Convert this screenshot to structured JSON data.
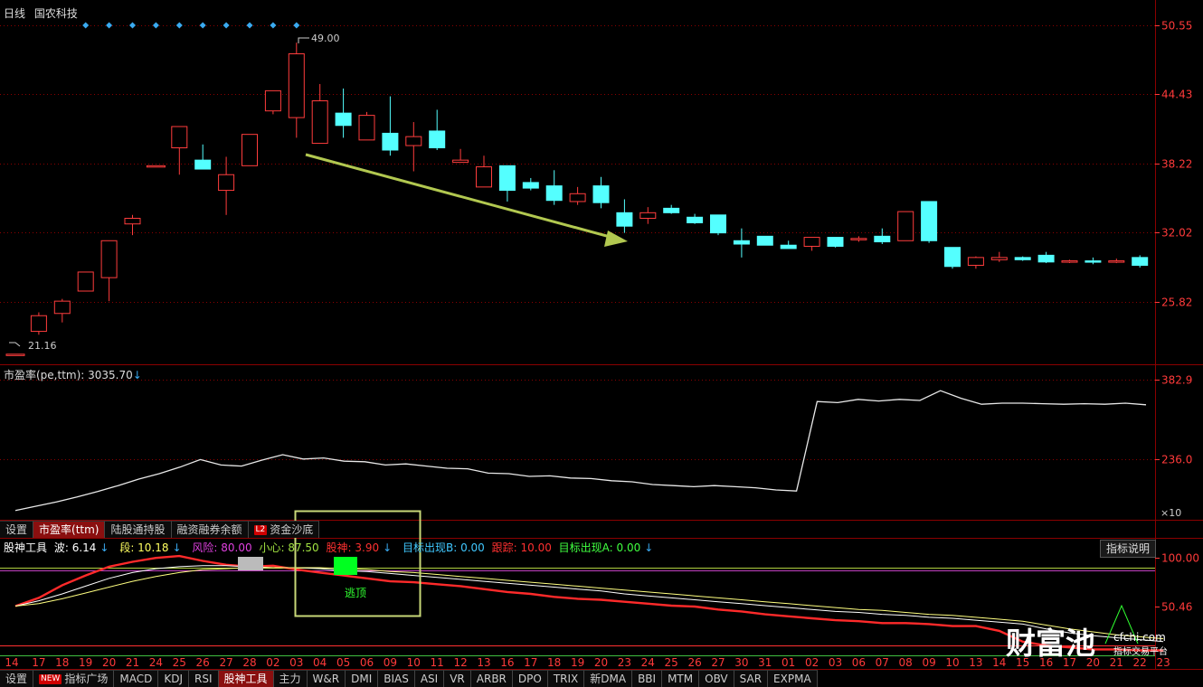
{
  "header": {
    "period": "日线",
    "stock_name": "国农科技"
  },
  "colors": {
    "up": "#ff3d3d",
    "down": "#54ffff",
    "axis_red": "#ff3a3a",
    "grid_red": "#8b0000",
    "pe_line": "#e8e8e8",
    "annotation_box": "#c8d878",
    "arrow": "#b2c850",
    "diamond": "#3aaaf0"
  },
  "chart_data": [
    {
      "type": "candlestick",
      "name": "price",
      "y_ticks": [
        "50.55",
        "44.43",
        "38.22",
        "32.02",
        "25.82"
      ],
      "ylim": [
        20.5,
        52.0
      ],
      "candles": [
        [
          21.16,
          21.16,
          21.16,
          21.16
        ],
        [
          23.2,
          24.6,
          22.9,
          24.9
        ],
        [
          24.8,
          25.9,
          24.0,
          26.1
        ],
        [
          26.8,
          28.5,
          26.8,
          28.5
        ],
        [
          28.0,
          31.3,
          25.9,
          31.3
        ],
        [
          32.8,
          33.3,
          31.8,
          33.6
        ],
        [
          38.0,
          38.0,
          38.0,
          38.0
        ],
        [
          39.6,
          41.5,
          37.2,
          41.5
        ],
        [
          38.5,
          37.7,
          37.7,
          39.9
        ],
        [
          35.8,
          37.2,
          33.6,
          38.8
        ],
        [
          38.0,
          40.8,
          38.0,
          40.8
        ],
        [
          42.9,
          44.7,
          42.6,
          44.7
        ],
        [
          42.3,
          48.0,
          40.5,
          49.0
        ],
        [
          40.0,
          43.8,
          40.0,
          45.3
        ],
        [
          42.7,
          41.6,
          40.5,
          44.9
        ],
        [
          40.3,
          42.5,
          40.3,
          42.8
        ],
        [
          40.9,
          39.4,
          38.9,
          44.2
        ],
        [
          39.8,
          40.6,
          37.5,
          41.9
        ],
        [
          41.1,
          39.6,
          39.4,
          43.0
        ],
        [
          38.3,
          38.5,
          38.3,
          39.5
        ],
        [
          36.1,
          37.9,
          36.1,
          38.9
        ],
        [
          38.0,
          35.8,
          34.8,
          38.0
        ],
        [
          36.5,
          36.0,
          35.8,
          36.9
        ],
        [
          36.2,
          34.9,
          34.5,
          37.6
        ],
        [
          34.8,
          35.5,
          34.5,
          36.1
        ],
        [
          36.2,
          34.7,
          34.2,
          37.0
        ],
        [
          33.8,
          32.6,
          32.0,
          35.0
        ],
        [
          33.3,
          33.8,
          32.8,
          34.3
        ],
        [
          34.2,
          33.8,
          33.7,
          34.5
        ],
        [
          33.4,
          32.9,
          32.8,
          33.7
        ],
        [
          33.6,
          32.0,
          31.8,
          33.6
        ],
        [
          31.3,
          31.0,
          29.8,
          32.4
        ],
        [
          31.7,
          30.9,
          30.9,
          31.7
        ],
        [
          30.9,
          30.6,
          30.6,
          31.3
        ],
        [
          30.8,
          31.6,
          30.4,
          31.6
        ],
        [
          31.6,
          30.8,
          30.7,
          31.6
        ],
        [
          31.4,
          31.5,
          31.2,
          31.7
        ],
        [
          31.7,
          31.2,
          31.0,
          32.4
        ],
        [
          31.3,
          33.9,
          31.3,
          33.9
        ],
        [
          34.8,
          31.3,
          31.1,
          34.8
        ],
        [
          30.7,
          29.0,
          28.8,
          30.7
        ],
        [
          29.1,
          29.8,
          28.8,
          29.9
        ],
        [
          29.6,
          29.8,
          29.4,
          30.3
        ],
        [
          29.8,
          29.6,
          29.5,
          29.9
        ],
        [
          30.0,
          29.4,
          29.3,
          30.3
        ],
        [
          29.5,
          29.5,
          29.3,
          29.6
        ],
        [
          29.5,
          29.4,
          29.2,
          29.8
        ],
        [
          29.5,
          29.5,
          29.3,
          29.7
        ],
        [
          29.8,
          29.1,
          28.9,
          30.0
        ]
      ],
      "annotations": {
        "high_label": "49.00",
        "low_label": "21.16"
      }
    },
    {
      "type": "line",
      "name": "pe_ttm",
      "title": "市盈率(pe,ttm): 3035.70",
      "y_ticks": [
        "382.9",
        "236.0"
      ],
      "ylim": [
        130,
        400
      ],
      "unit_label": "×10",
      "values": [
        142,
        150,
        158,
        167,
        177,
        188,
        200,
        210,
        222,
        236,
        226,
        224,
        235,
        245,
        237,
        239,
        233,
        232,
        226,
        228,
        224,
        220,
        219,
        211,
        210,
        205,
        206,
        202,
        201,
        197,
        195,
        190,
        188,
        186,
        188,
        186,
        184,
        180,
        178,
        343,
        341,
        347,
        344,
        347,
        345,
        363,
        349,
        338,
        340,
        340,
        339,
        338,
        339,
        338,
        340,
        337
      ]
    },
    {
      "type": "line",
      "name": "gushen_tool",
      "y_ticks": [
        "100.00",
        "50.46"
      ],
      "ylim": [
        -2,
        103
      ],
      "ref_lines": [
        {
          "value": 90,
          "color": "#b0d040"
        },
        {
          "value": 87.5,
          "color": "#c040c0"
        },
        {
          "value": 10,
          "color": "#ff3030"
        },
        {
          "value": 0,
          "color": "#40c040"
        }
      ],
      "series": [
        {
          "color": "#ff2a2a",
          "values": [
            50.5,
            59,
            72,
            82,
            91,
            96,
            100,
            102,
            97,
            93,
            91,
            92,
            88,
            85,
            82,
            79,
            76,
            75,
            73,
            71,
            68,
            65,
            63,
            60,
            58,
            57,
            55,
            53,
            51,
            50,
            47,
            45,
            42,
            40,
            38,
            36,
            35,
            33,
            33,
            32,
            30,
            30,
            25,
            14,
            10,
            8,
            6,
            6,
            5,
            5
          ]
        },
        {
          "color": "#ffffff",
          "values": [
            50.5,
            56,
            63,
            71,
            79,
            85,
            89,
            91,
            92,
            92,
            91,
            90,
            90,
            89,
            87,
            86,
            84,
            82,
            80,
            78,
            76,
            74,
            72,
            70,
            68,
            66,
            63,
            61,
            59,
            57,
            55,
            53,
            51,
            49,
            47,
            45,
            44,
            42,
            41,
            39,
            38,
            36,
            34,
            32,
            27,
            23,
            20,
            18,
            16,
            14
          ]
        },
        {
          "color": "#ffff80",
          "values": [
            50.5,
            53,
            58,
            64,
            70,
            76,
            81,
            85,
            88,
            89,
            90,
            90,
            90,
            90,
            89,
            88,
            86,
            85,
            83,
            81,
            79,
            77,
            75,
            73,
            71,
            69,
            67,
            65,
            63,
            61,
            59,
            57,
            55,
            53,
            51,
            49,
            47,
            46,
            44,
            42,
            41,
            39,
            37,
            35,
            31,
            27,
            24,
            21,
            19,
            17
          ]
        }
      ]
    }
  ],
  "pe_title": "市盈率(pe,ttm): 3035.70",
  "pe_unit": "×10",
  "indicator_legend": {
    "name": "股神工具",
    "wave": "波: 6.14",
    "segment": "段: 10.18",
    "risk": "风险: 80.00",
    "careful": "小心: 87.50",
    "gushen": "股神: 3.90",
    "target_b": "目标出现B: 0.00",
    "track": "跟踪: 10.00",
    "target_a": "目标出现A: 0.00"
  },
  "escape_label": "逃顶",
  "help_button": "指标说明",
  "upper_tabs": [
    {
      "label": "设置",
      "active": false
    },
    {
      "label": "市盈率(ttm)",
      "active": true
    },
    {
      "label": "陆股通持股",
      "active": false
    },
    {
      "label": "融资融券余额",
      "active": false
    },
    {
      "label": "资金沙底",
      "active": false,
      "badge": "L2"
    }
  ],
  "bottom_tabs": [
    {
      "label": "设置",
      "active": false
    },
    {
      "label": "指标广场",
      "active": false,
      "badge": "NEW"
    },
    {
      "label": "MACD",
      "active": false
    },
    {
      "label": "KDJ",
      "active": false
    },
    {
      "label": "RSI",
      "active": false
    },
    {
      "label": "股神工具",
      "active": true
    },
    {
      "label": "主力",
      "active": false
    },
    {
      "label": "W&R",
      "active": false
    },
    {
      "label": "DMI",
      "active": false
    },
    {
      "label": "BIAS",
      "active": false
    },
    {
      "label": "ASI",
      "active": false
    },
    {
      "label": "VR",
      "active": false
    },
    {
      "label": "ARBR",
      "active": false
    },
    {
      "label": "DPO",
      "active": false
    },
    {
      "label": "TRIX",
      "active": false
    },
    {
      "label": "新DMA",
      "active": false
    },
    {
      "label": "BBI",
      "active": false
    },
    {
      "label": "MTM",
      "active": false
    },
    {
      "label": "OBV",
      "active": false
    },
    {
      "label": "SAR",
      "active": false
    },
    {
      "label": "EXPMA",
      "active": false
    }
  ],
  "date_labels": [
    "14",
    "17",
    "18",
    "19",
    "20",
    "21",
    "24",
    "25",
    "26",
    "27",
    "28",
    "02",
    "03",
    "04",
    "05",
    "06",
    "09",
    "10",
    "11",
    "12",
    "13",
    "16",
    "17",
    "18",
    "19",
    "20",
    "23",
    "24",
    "25",
    "26",
    "27",
    "30",
    "31",
    "01",
    "02",
    "03",
    "06",
    "07",
    "08",
    "09",
    "10",
    "13",
    "14",
    "15",
    "16",
    "17",
    "20",
    "21",
    "22",
    "23"
  ],
  "watermark": {
    "brand": "财富池",
    "domain": "cfchi.com",
    "tagline": "指标交易平台"
  }
}
